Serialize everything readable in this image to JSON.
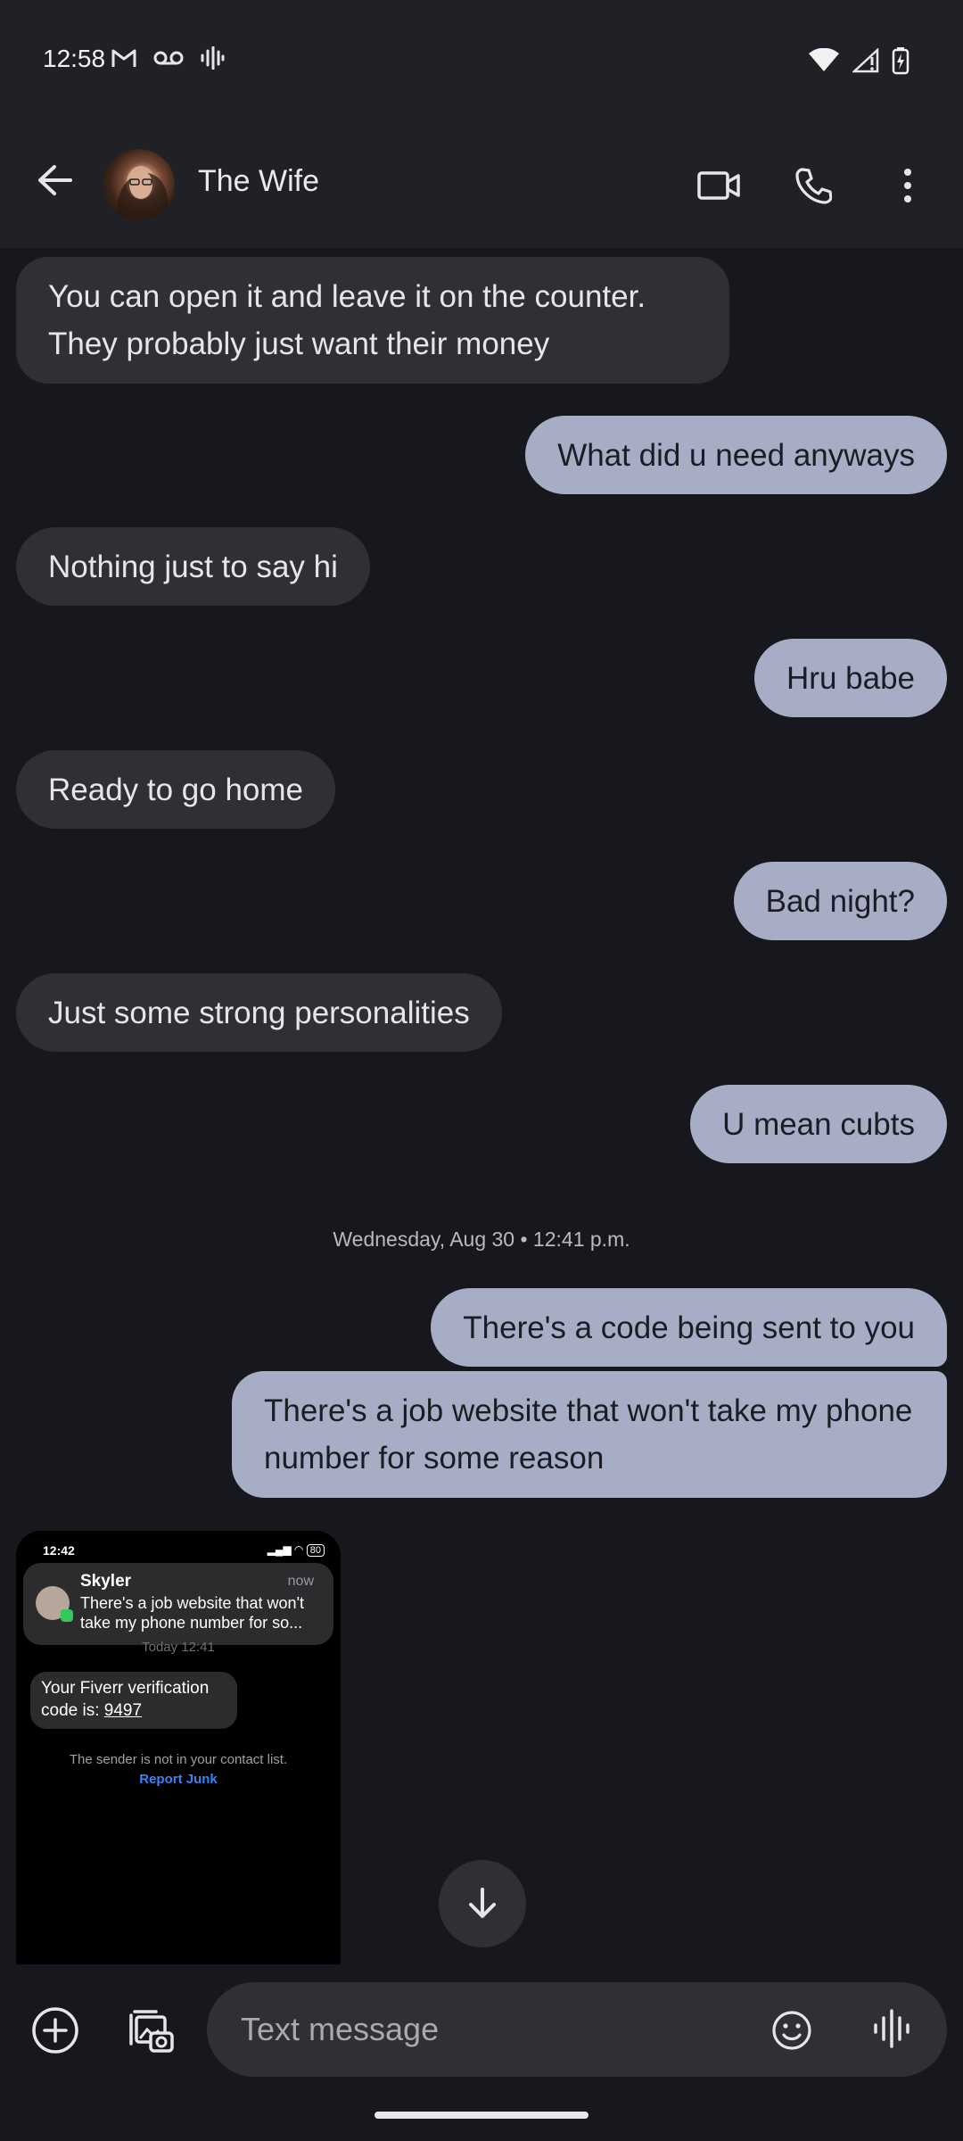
{
  "status_bar": {
    "time": "12:58",
    "left_icons": [
      "gmail-icon",
      "voicemail-icon",
      "sound-wave-icon"
    ],
    "right_icons": [
      "wifi-icon",
      "signal-icon",
      "battery-charging-icon"
    ]
  },
  "header": {
    "contact_name": "The Wife",
    "actions": [
      "back-icon",
      "video-call-icon",
      "phone-icon",
      "more-vert-icon"
    ]
  },
  "messages": [
    {
      "direction": "incoming",
      "text_lines": [
        "You can open it and leave it on the counter.",
        "They probably just want their money"
      ]
    },
    {
      "direction": "outgoing",
      "text": "What did u need anyways"
    },
    {
      "direction": "incoming",
      "text": "Nothing just to say hi"
    },
    {
      "direction": "outgoing",
      "text": "Hru babe"
    },
    {
      "direction": "incoming",
      "text": "Ready to go home"
    },
    {
      "direction": "outgoing",
      "text": "Bad night?"
    },
    {
      "direction": "incoming",
      "text": "Just some strong personalities"
    },
    {
      "direction": "outgoing",
      "text": "U mean cubts"
    },
    {
      "direction": "outgoing",
      "text": "There's a code being sent to you"
    },
    {
      "direction": "outgoing",
      "text_lines": [
        "There's a job website that won't take my phone",
        "number for some reason"
      ]
    }
  ],
  "date_separator": "Wednesday, Aug 30 • 12:41 p.m.",
  "attachment": {
    "status_time": "12:42",
    "status_battery": "80",
    "notification_name": "Skyler",
    "notification_time": "now",
    "notification_text_lines": [
      "There's a job website that won't",
      "take my phone number for so..."
    ],
    "today_label": "Today 12:41",
    "message_prefix": "Your Fiverr verification",
    "message_line2_prefix": "code is: ",
    "message_code": "9497",
    "sender_note": "The sender is not in your contact list.",
    "report_link": "Report Junk"
  },
  "compose": {
    "placeholder": "Text message",
    "icons": [
      "add-icon",
      "gallery-icon",
      "emoji-icon",
      "voice-icon"
    ]
  },
  "colors": {
    "background": "#17181d",
    "incoming_bubble": "#2f3035",
    "outgoing_bubble": "#a8adc6",
    "link_blue": "#3b82f6"
  }
}
